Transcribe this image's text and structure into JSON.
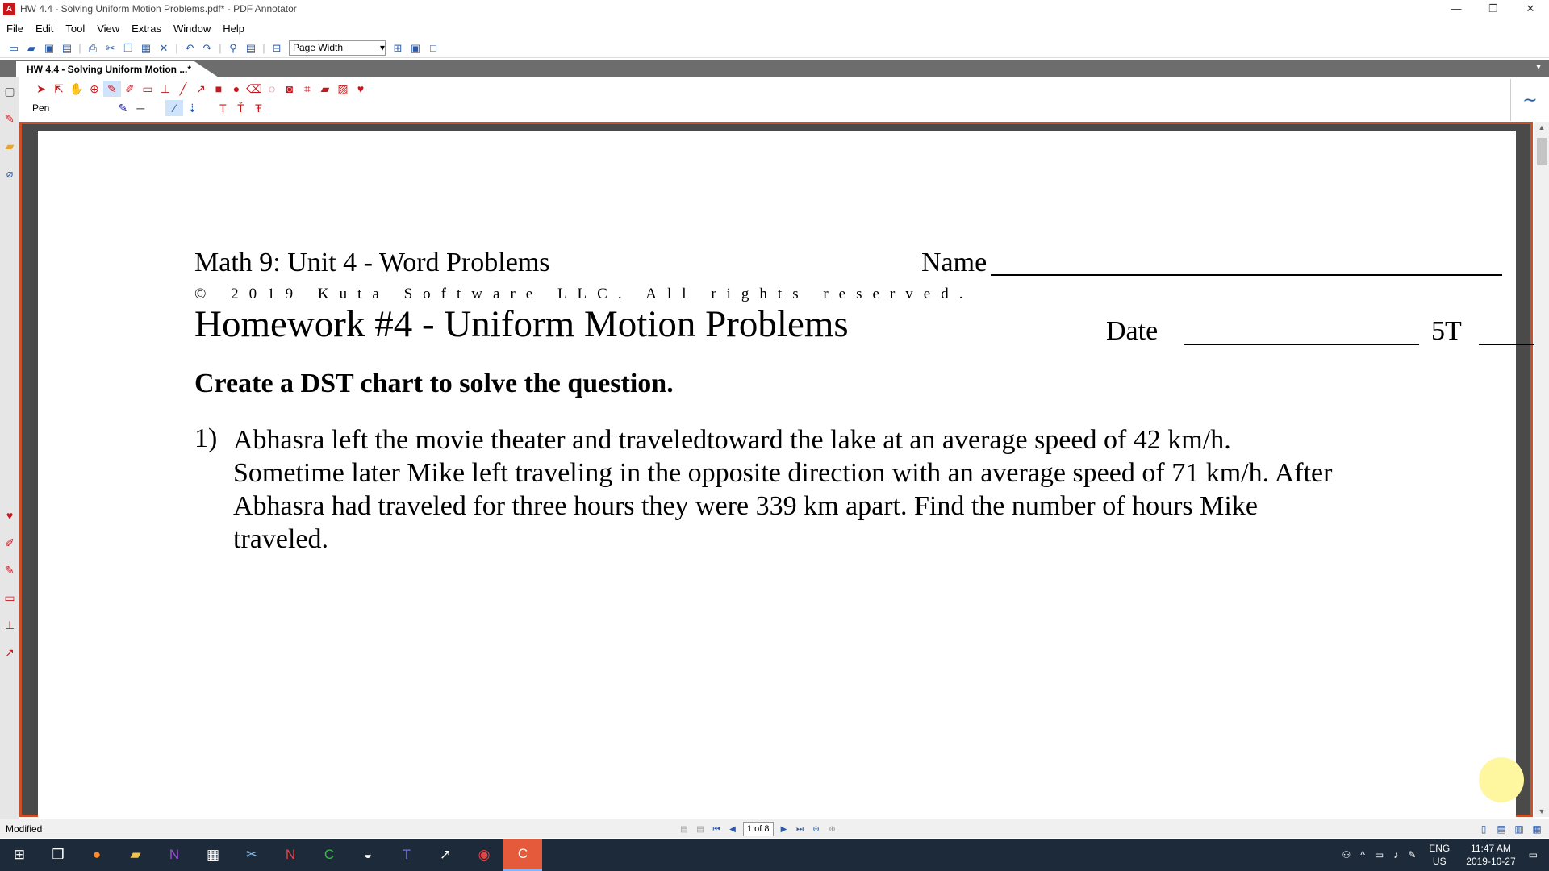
{
  "window": {
    "title": "HW 4.4 - Solving Uniform Motion Problems.pdf* - PDF Annotator",
    "controls": [
      "—",
      "❐",
      "✕"
    ]
  },
  "menu": [
    "File",
    "Edit",
    "Tool",
    "View",
    "Extras",
    "Window",
    "Help"
  ],
  "toolbar": {
    "zoom_value": "Page Width"
  },
  "tab": {
    "label": "HW 4.4 - Solving Uniform Motion ...*"
  },
  "annotation": {
    "tool_label": "Pen"
  },
  "document": {
    "header_left": "Math 9: Unit 4 - Word Problems",
    "name_label": "Name",
    "copyright": "© 2019 Kuta Software LLC. All rights reserved.",
    "title": "Homework #4 - Uniform Motion Problems",
    "date_label": "Date",
    "period_label": "5T",
    "instruction": "Create a DST chart to solve the question.",
    "question_number": "1)",
    "question_line1": "Abhasra left the movie theater and traveledtoward the lake at an average speed of 42 km/h.",
    "question_line2": "Sometime later Mike left traveling in the opposite direction with an average speed of 71 km/h.  After",
    "question_line3": "Abhasra had traveled for three hours they were 339 km apart. Find the number of hours Mike",
    "question_line4": "traveled."
  },
  "status": {
    "left": "Modified",
    "page_indicator": "1 of 8"
  },
  "tray": {
    "lang": "ENG",
    "region": "US",
    "time": "11:47 AM",
    "date": "2019-10-27"
  },
  "colors": {
    "accent_red": "#c8161d",
    "doc_border": "#c8502a",
    "taskbar": "#1c2a3a"
  }
}
